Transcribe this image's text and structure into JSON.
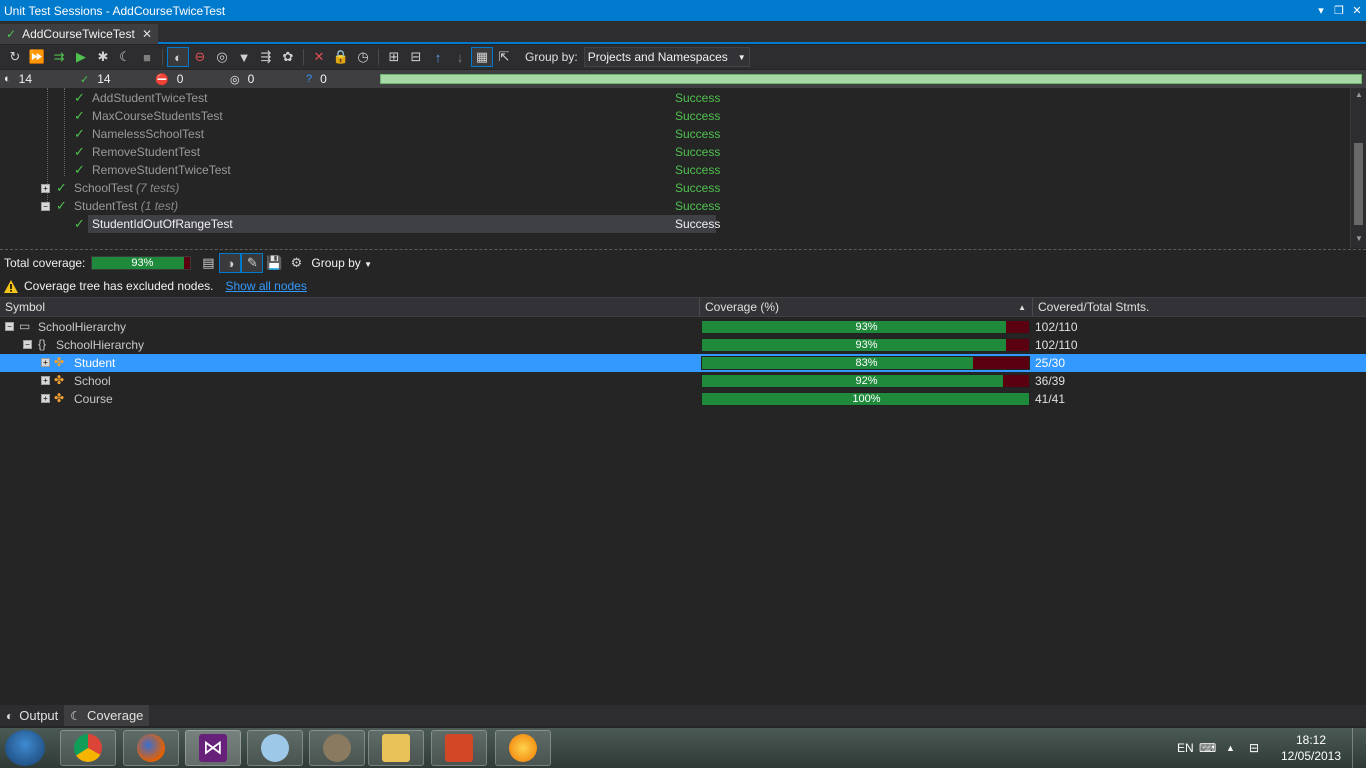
{
  "window": {
    "title": "Unit Test Sessions - AddCourseTwiceTest"
  },
  "tab": {
    "label": "AddCourseTwiceTest"
  },
  "toolbar": {
    "group_by_label": "Group by:",
    "group_by_value": "Projects and Namespaces"
  },
  "stats": {
    "total": "14",
    "passed": "14",
    "failed": "0",
    "ignored": "0",
    "unknown": "0"
  },
  "tests": [
    {
      "name": "AddStudentTwiceTest",
      "suffix": "",
      "result": "Success"
    },
    {
      "name": "MaxCourseStudentsTest",
      "suffix": "",
      "result": "Success"
    },
    {
      "name": "NamelessSchoolTest",
      "suffix": "",
      "result": "Success"
    },
    {
      "name": "RemoveStudentTest",
      "suffix": "",
      "result": "Success"
    },
    {
      "name": "RemoveStudentTwiceTest",
      "suffix": "",
      "result": "Success"
    },
    {
      "name": "SchoolTest",
      "suffix": "(7 tests)",
      "result": "Success"
    },
    {
      "name": "StudentTest",
      "suffix": "(1 test)",
      "result": "Success"
    },
    {
      "name": "StudentIdOutOfRangeTest",
      "suffix": "",
      "result": "Success"
    }
  ],
  "coverage": {
    "total_label": "Total coverage:",
    "total_pct": "93%",
    "total_value": 0.93,
    "group_by": "Group by",
    "notice": "Coverage tree has excluded nodes.",
    "show_all": "Show all nodes",
    "columns": {
      "symbol": "Symbol",
      "coverage": "Coverage (%)",
      "stmts": "Covered/Total Stmts."
    },
    "rows": [
      {
        "name": "SchoolHierarchy",
        "pct": "93%",
        "value": 0.93,
        "stmts": "102/110"
      },
      {
        "name": "SchoolHierarchy",
        "pct": "93%",
        "value": 0.93,
        "stmts": "102/110"
      },
      {
        "name": "Student",
        "pct": "83%",
        "value": 0.83,
        "stmts": "25/30"
      },
      {
        "name": "School",
        "pct": "92%",
        "value": 0.92,
        "stmts": "36/39"
      },
      {
        "name": "Course",
        "pct": "100%",
        "value": 1.0,
        "stmts": "41/41"
      }
    ]
  },
  "bottom_tabs": {
    "output": "Output",
    "coverage": "Coverage"
  },
  "taskbar": {
    "lang": "EN",
    "time": "18:12",
    "date": "12/05/2013"
  },
  "colors": {
    "accent": "#007acc",
    "success": "#4ec14e",
    "covered": "#1f8a3c",
    "uncovered": "#5a0010",
    "selection": "#3399ff"
  }
}
